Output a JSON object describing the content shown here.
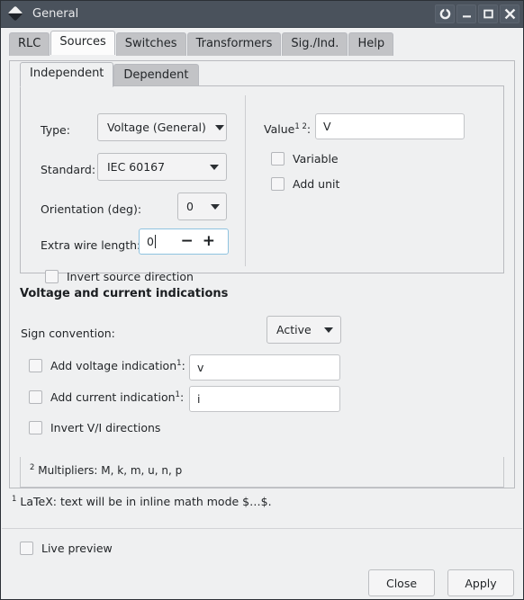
{
  "window": {
    "title": "General",
    "icon": "diamond-logo-icon",
    "buttons": [
      {
        "name": "shade-button",
        "label": ""
      },
      {
        "name": "minimize-button",
        "label": ""
      },
      {
        "name": "maximize-button",
        "label": ""
      },
      {
        "name": "close-button",
        "label": ""
      }
    ]
  },
  "tabs": {
    "items": [
      {
        "label": "RLC",
        "selected": false
      },
      {
        "label": "Sources",
        "selected": true
      },
      {
        "label": "Switches",
        "selected": false
      },
      {
        "label": "Transformers",
        "selected": false
      },
      {
        "label": "Sig./Ind.",
        "selected": false
      },
      {
        "label": "Help",
        "selected": false
      }
    ]
  },
  "subtabs": {
    "items": [
      {
        "label": "Independent",
        "selected": true
      },
      {
        "label": "Dependent",
        "selected": false
      }
    ]
  },
  "independent": {
    "type_label": "Type:",
    "type_value": "Voltage (General)",
    "standard_label": "Standard:",
    "standard_value": "IEC 60167",
    "orientation_label": "Orientation (deg):",
    "orientation_value": "0",
    "extra_wire_label": "Extra wire length:",
    "extra_wire_value": "0",
    "spin_minus": "−",
    "spin_plus": "+",
    "invert_source_label": "Invert source direction",
    "invert_source_checked": false,
    "value_label": "Value",
    "value_label_sup": "1 2",
    "value_label_colon": ":",
    "value_text": "V",
    "variable_label": "Variable",
    "variable_checked": false,
    "add_unit_label": "Add unit",
    "add_unit_checked": false
  },
  "indications": {
    "section_title": "Voltage and current indications",
    "sign_convention_label": "Sign convention:",
    "sign_convention_value": "Active",
    "add_voltage_label": "Add voltage indication",
    "add_voltage_sup": "1",
    "add_voltage_colon": ":",
    "add_voltage_checked": false,
    "voltage_text": "v",
    "add_current_label": "Add current indication",
    "add_current_sup": "1",
    "add_current_colon": ":",
    "add_current_checked": false,
    "current_text": "i",
    "invert_vi_label": "Invert V/I directions",
    "invert_vi_checked": false
  },
  "footnotes": {
    "multipliers_sup": "2",
    "multipliers_text": " Multipliers: M, k, m, u, n, p",
    "latex_sup": "1",
    "latex_text": " LaTeX: text will be in inline math mode $…$."
  },
  "bottom": {
    "live_preview_label": "Live preview",
    "live_preview_checked": false,
    "close_label": "Close",
    "apply_label": "Apply"
  },
  "colors": {
    "titlebar": "#4a525c",
    "window_bg": "#eff0f1",
    "field_bg": "#ffffff",
    "focus_border": "#8fc3e0",
    "tab_selected": "#fcfcfc",
    "tab_normal": "#c2c3c6"
  }
}
